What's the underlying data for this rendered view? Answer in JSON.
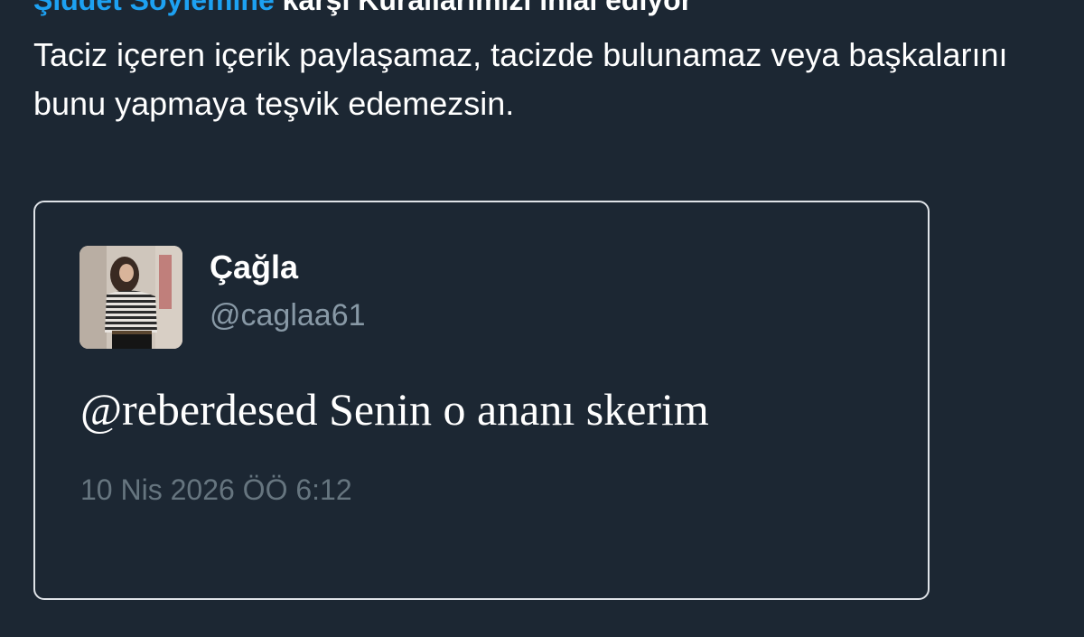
{
  "notice": {
    "link_text": "Şiddet Söylemine",
    "rest_text": " karşı Kurallarımızı ihlal ediyor",
    "description": "Taciz içeren içerik paylaşamaz, tacizde bulunamaz veya başkalarını bunu yapmaya teşvik edemezsin."
  },
  "quoted_tweet": {
    "display_name": "Çağla",
    "handle": "@caglaa61",
    "text": "@reberdesed Senin o ananı skerim",
    "timestamp": "10 Nis 2026 ÖÖ 6:12"
  },
  "colors": {
    "background": "#1c2733",
    "link": "#1da1f2",
    "secondary_text": "#8899a6",
    "timestamp_text": "#66757f",
    "card_border": "#dfe3e8"
  }
}
